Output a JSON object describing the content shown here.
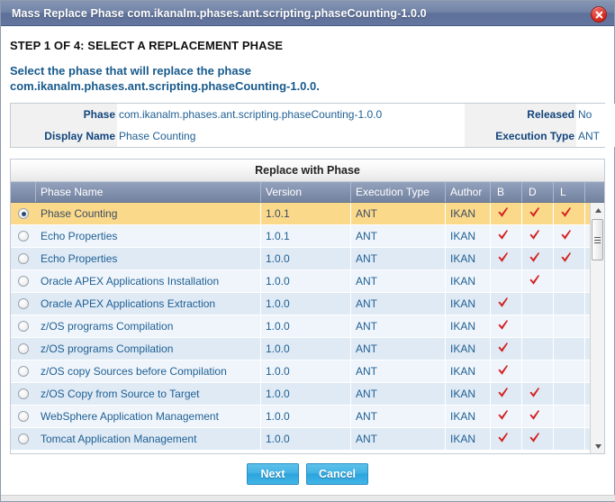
{
  "window": {
    "title": "Mass Replace Phase com.ikanalm.phases.ant.scripting.phaseCounting-1.0.0",
    "close_icon": "close-icon"
  },
  "step": {
    "title": "STEP 1 OF 4: SELECT A REPLACEMENT PHASE",
    "instruction_line1": "Select the phase that will replace the phase",
    "instruction_line2": "com.ikanalm.phases.ant.scripting.phaseCounting-1.0.0."
  },
  "info": {
    "phase_label": "Phase",
    "phase_value": "com.ikanalm.phases.ant.scripting.phaseCounting-1.0.0",
    "released_label": "Released",
    "released_value": "No",
    "display_name_label": "Display Name",
    "display_name_value": "Phase Counting",
    "execution_type_label": "Execution Type",
    "execution_type_value": "ANT"
  },
  "grid": {
    "caption": "Replace with Phase",
    "columns": [
      "",
      "Phase Name",
      "Version",
      "Execution Type",
      "Author",
      "B",
      "D",
      "L"
    ],
    "rows": [
      {
        "selected": true,
        "name": "Phase Counting",
        "version": "1.0.1",
        "exec": "ANT",
        "author": "IKAN",
        "b": true,
        "d": true,
        "l": true
      },
      {
        "selected": false,
        "name": "Echo Properties",
        "version": "1.0.1",
        "exec": "ANT",
        "author": "IKAN",
        "b": true,
        "d": true,
        "l": true
      },
      {
        "selected": false,
        "name": "Echo Properties",
        "version": "1.0.0",
        "exec": "ANT",
        "author": "IKAN",
        "b": true,
        "d": true,
        "l": true
      },
      {
        "selected": false,
        "name": "Oracle APEX Applications Installation",
        "version": "1.0.0",
        "exec": "ANT",
        "author": "IKAN",
        "b": false,
        "d": true,
        "l": false
      },
      {
        "selected": false,
        "name": "Oracle APEX Applications Extraction",
        "version": "1.0.0",
        "exec": "ANT",
        "author": "IKAN",
        "b": true,
        "d": false,
        "l": false
      },
      {
        "selected": false,
        "name": "z/OS programs Compilation",
        "version": "1.0.0",
        "exec": "ANT",
        "author": "IKAN",
        "b": true,
        "d": false,
        "l": false
      },
      {
        "selected": false,
        "name": "z/OS programs Compilation",
        "version": "1.0.0",
        "exec": "ANT",
        "author": "IKAN",
        "b": true,
        "d": false,
        "l": false
      },
      {
        "selected": false,
        "name": "z/OS copy Sources before Compilation",
        "version": "1.0.0",
        "exec": "ANT",
        "author": "IKAN",
        "b": true,
        "d": false,
        "l": false,
        "wrap": true
      },
      {
        "selected": false,
        "name": "z/OS Copy from Source to Target",
        "version": "1.0.0",
        "exec": "ANT",
        "author": "IKAN",
        "b": true,
        "d": true,
        "l": false
      },
      {
        "selected": false,
        "name": "WebSphere Application Management",
        "version": "1.0.0",
        "exec": "ANT",
        "author": "IKAN",
        "b": true,
        "d": true,
        "l": false
      },
      {
        "selected": false,
        "name": "Tomcat Application Management",
        "version": "1.0.0",
        "exec": "ANT",
        "author": "IKAN",
        "b": true,
        "d": true,
        "l": false
      }
    ],
    "scrollbar": {
      "up_icon": "scroll-up-arrow-icon",
      "down_icon": "scroll-down-arrow-icon"
    }
  },
  "footer": {
    "next_label": "Next",
    "cancel_label": "Cancel"
  },
  "colors": {
    "titlebar": "#73839f",
    "selected_row": "#fbd98a",
    "row_odd": "#dfeaf5",
    "row_even": "#eff5fb",
    "check_red": "#d32020",
    "button_blue": "#41b6e6",
    "heading_blue": "#185a8c"
  }
}
